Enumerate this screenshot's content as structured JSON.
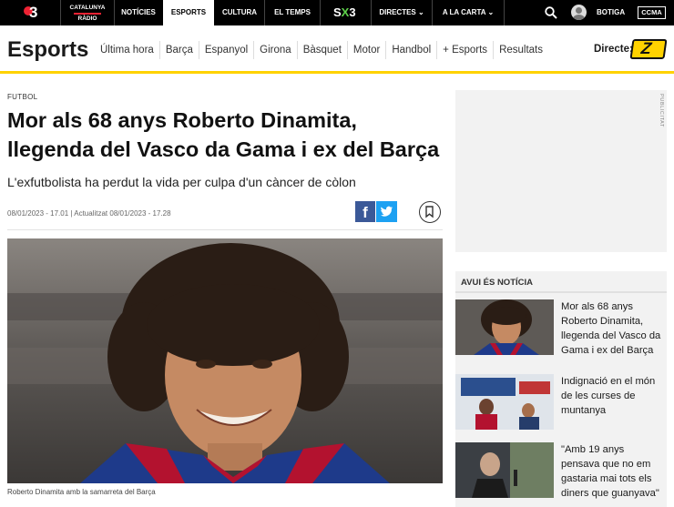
{
  "topbar": {
    "brand_logo": "3",
    "radio_line1": "CATALUNYA",
    "radio_line2": "RÀDIO",
    "nav": [
      {
        "label": "NOTÍCIES"
      },
      {
        "label": "ESPORTS"
      },
      {
        "label": "CULTURA"
      },
      {
        "label": "EL TEMPS"
      }
    ],
    "sx3_a": "S",
    "sx3_b": "X",
    "sx3_c": "3",
    "directes_label": "DIRECTES ⌄",
    "alacarta_label": "A LA CARTA ⌄",
    "botiga_label": "BOTIGA",
    "ccma_label": "CCMA"
  },
  "section": {
    "title": "Esports",
    "links": [
      "Última hora",
      "Barça",
      "Espanyol",
      "Girona",
      "Bàsquet",
      "Motor",
      "Handbol",
      "+ Esports",
      "Resultats"
    ],
    "directe_label": "Directe:",
    "directe_logo": "Z"
  },
  "article": {
    "kicker": "FUTBOL",
    "headline": "Mor als 68 anys Roberto Dinamita, llegenda del Vasco da Gama i ex del Barça",
    "subhead": "L'exfutbolista ha perdut la vida per culpa d'un càncer de còlon",
    "dates": "08/01/2023 - 17.01 | Actualitzat 08/01/2023 - 17.28",
    "fb_label": "f",
    "caption": "Roberto Dinamita amb la samarreta del Barça"
  },
  "sidebar": {
    "ad_label": "PUBLICITAT",
    "news_header": "AVUI ÉS NOTÍCIA",
    "items": [
      {
        "text": "Mor als 68 anys Roberto Dinamita, llegenda del Vasco da Gama i ex del Barça"
      },
      {
        "text": "Indignació en el món de les curses de muntanya"
      },
      {
        "text": "\"Amb 19 anys pensava que no em gastaria mai tots els diners que guanyava\""
      }
    ]
  },
  "colors": {
    "accent_yellow": "#ffd200",
    "facebook": "#3b5998",
    "twitter": "#1da1f2",
    "topbar_bg": "#000000"
  }
}
